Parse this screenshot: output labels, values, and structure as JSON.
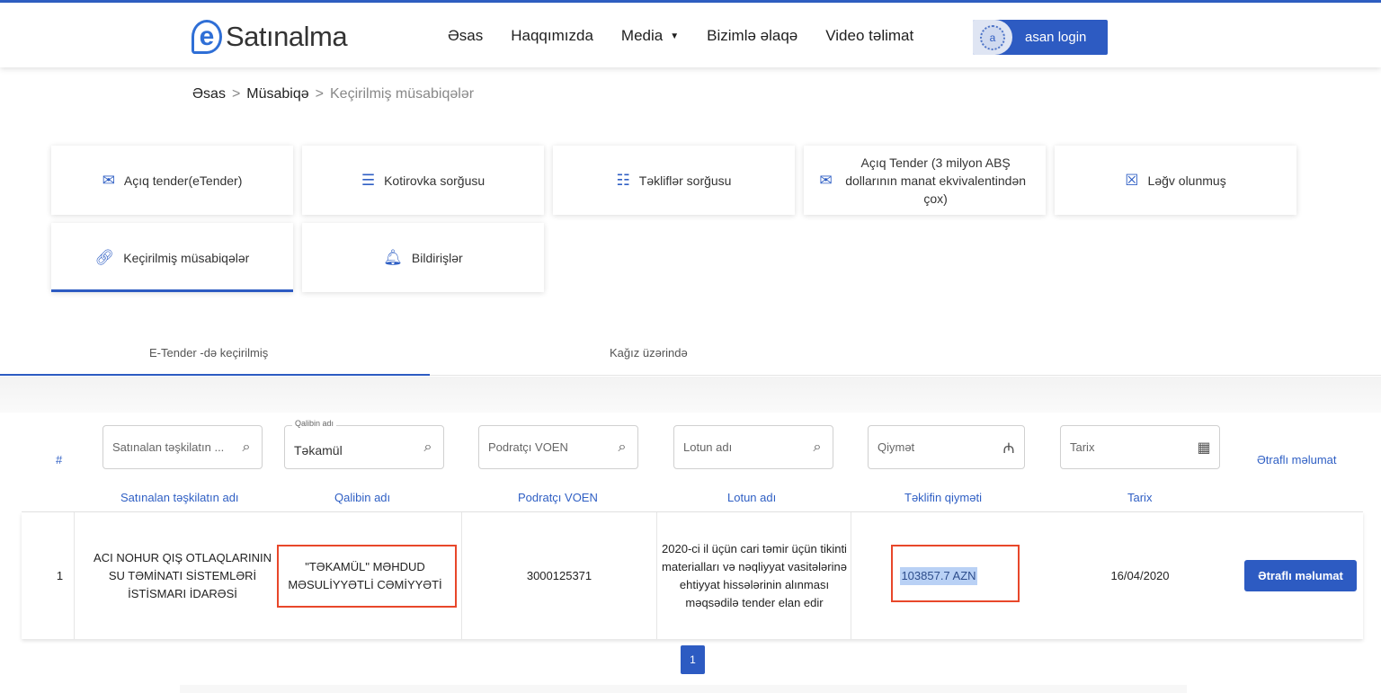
{
  "header": {
    "logo_letter": "e",
    "logo_text": "Satınalma",
    "nav": [
      {
        "label": "Əsas"
      },
      {
        "label": "Haqqımızda"
      },
      {
        "label": "Media"
      },
      {
        "label": "Bizimlə əlaqə"
      },
      {
        "label": "Video təlimat"
      }
    ],
    "asan_login": "asan login",
    "asan_seal_letter": "a"
  },
  "breadcrumb": {
    "items": [
      "Əsas",
      "Müsabiqə",
      "Keçirilmiş müsabiqələr"
    ],
    "separator": ">"
  },
  "categories": [
    {
      "label": "Açıq tender(eTender)",
      "icon": "tender-doc-icon"
    },
    {
      "label": "Kotirovka sorğusu",
      "icon": "quote-message-icon"
    },
    {
      "label": "Təkliflər sorğusu",
      "icon": "offers-chat-icon"
    },
    {
      "label": "Açıq Tender (3 milyon ABŞ dollarının manat ekvivalentindən çox)",
      "icon": "tender-doc-icon"
    },
    {
      "label": "Ləğv olunmuş",
      "icon": "cancel-box-icon"
    },
    {
      "label": "Keçirilmiş müsabiqələr",
      "icon": "link-icon",
      "active": true
    },
    {
      "label": "Bildirişlər",
      "icon": "bell-icon"
    }
  ],
  "tabs": {
    "etender": "E-Tender -də keçirilmiş",
    "paper": "Kağız üzərində"
  },
  "filters": {
    "org_placeholder": "Satınalan təşkilatın ...",
    "template_legend": "Qalibin adı",
    "template_value": "Təkamül",
    "voen_placeholder": "Podratçı VOEN",
    "lot_placeholder": "Lotun adı",
    "price_placeholder": "Qiymət",
    "date_placeholder": "Tarix",
    "currency_symbol": "₼"
  },
  "table": {
    "hash": "#",
    "more_header": "Ətraflı məlumat",
    "columns": [
      "Satınalan təşkilatın adı",
      "Qalibin adı",
      "Podratçı VOEN",
      "Lotun adı",
      "Təklifin qiyməti",
      "Tarix"
    ],
    "rows": [
      {
        "index": "1",
        "org": "ACI NOHUR QIŞ OTLAQLARININ SU TƏMİNATI SİSTEMLƏRİ İSTİSMARI İDARƏSİ",
        "winner": "\"TƏKAMÜL\" MƏHDUD MƏSULİYYƏTLİ CƏMİYYƏTİ",
        "voen": "3000125371",
        "lot": "2020-ci il üçün cari təmir üçün tikinti materialları və nəqliyyat vasitələrinə ehtiyyat hissələrinin alınması məqsədilə tender elan edir",
        "price": "103857.7 AZN",
        "date": "16/04/2020",
        "more_button": "Ətraflı məlumat"
      }
    ]
  },
  "pagination": {
    "current": "1"
  },
  "colors": {
    "primary": "#2d5bc2",
    "highlight": "#e8472a"
  }
}
